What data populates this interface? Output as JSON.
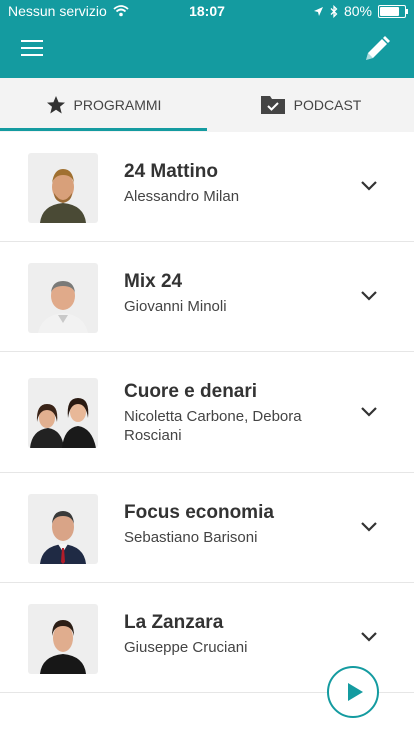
{
  "status_bar": {
    "carrier": "Nessun servizio",
    "time": "18:07",
    "battery_percent": "80%",
    "battery_level": 0.8
  },
  "app_bar": {
    "menu_icon": "hamburger-menu-icon",
    "edit_icon": "pencil-icon"
  },
  "tabs": [
    {
      "label": "PROGRAMMI",
      "icon": "star-icon",
      "selected": true
    },
    {
      "label": "PODCAST",
      "icon": "folder-check-icon",
      "selected": false
    }
  ],
  "programs": [
    {
      "title": "24 Mattino",
      "host": "Alessandro Milan"
    },
    {
      "title": "Mix 24",
      "host": "Giovanni Minoli"
    },
    {
      "title": "Cuore e denari",
      "host": "Nicoletta Carbone, Debora Rosciani"
    },
    {
      "title": "Focus economia",
      "host": "Sebastiano Barisoni"
    },
    {
      "title": "La Zanzara",
      "host": "Giuseppe Cruciani"
    }
  ],
  "player": {
    "icon": "play-icon"
  },
  "colors": {
    "accent": "#149ba0",
    "text": "#333333",
    "divider": "#e6e6e6"
  }
}
